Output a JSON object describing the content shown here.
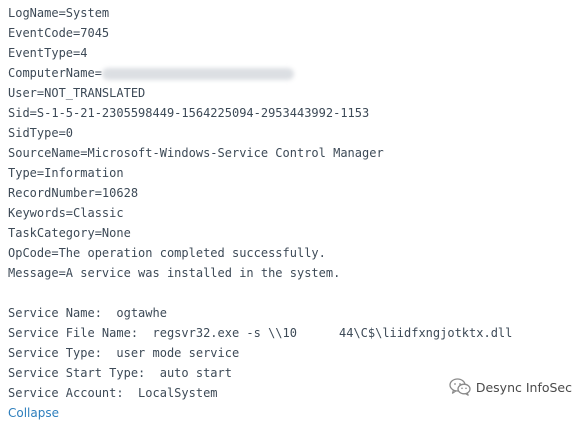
{
  "event": {
    "log_name": "LogName=System",
    "event_code": "EventCode=7045",
    "event_type": "EventType=4",
    "computer_name": "ComputerName=",
    "user": "User=NOT_TRANSLATED",
    "sid": "Sid=S-1-5-21-2305598449-1564225094-2953443992-1153",
    "sid_type": "SidType=0",
    "source_name": "SourceName=Microsoft-Windows-Service Control Manager",
    "type": "Type=Information",
    "record_number": "RecordNumber=10628",
    "keywords": "Keywords=Classic",
    "task_category": "TaskCategory=None",
    "op_code": "OpCode=The operation completed successfully.",
    "message": "Message=A service was installed in the system."
  },
  "service": {
    "name": "Service Name:  ogtawhe",
    "file_name_prefix": "Service File Name:  regsvr32.exe -s \\\\10",
    "file_name_suffix": "44\\C$\\liidfxngjotktx.dll",
    "type": "Service Type:  user mode service",
    "start_type": "Service Start Type:  auto start",
    "account": "Service Account:  LocalSystem"
  },
  "actions": {
    "collapse_label": "Collapse"
  },
  "watermark": {
    "text": "Desync InfoSec",
    "icon": "wechat-logo-icon"
  },
  "colors": {
    "text": "#3d4a57",
    "link": "#2e7fbd",
    "background": "#ffffff"
  }
}
